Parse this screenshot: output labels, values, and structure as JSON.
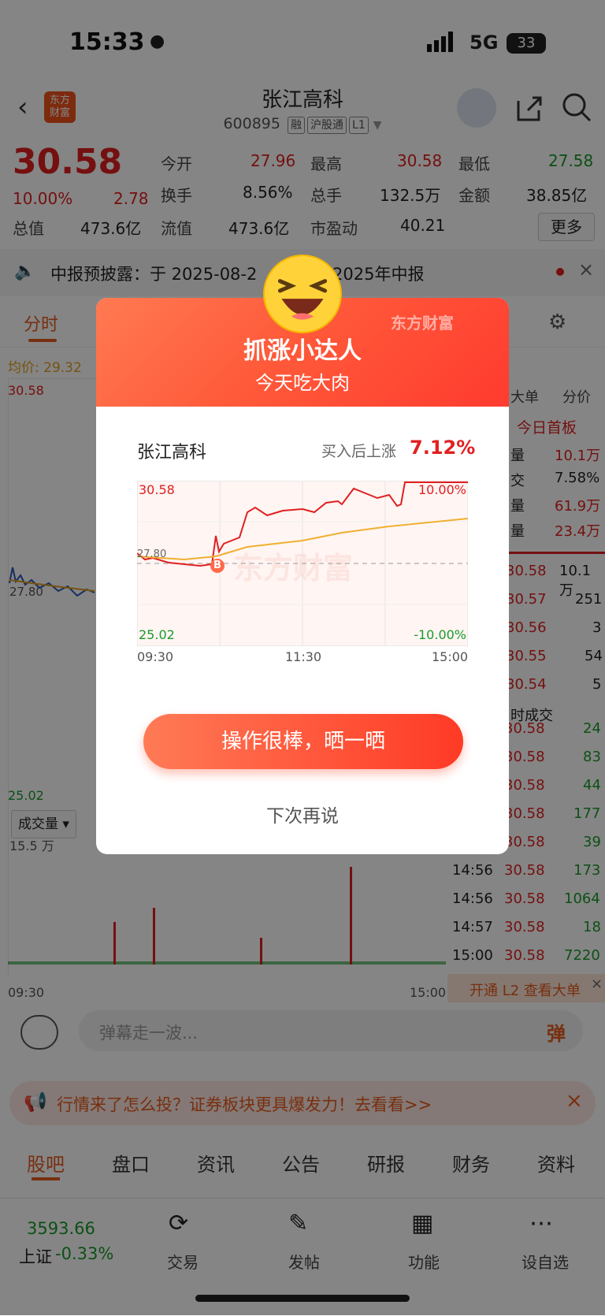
{
  "status_bar": {
    "time": "15:33",
    "network": "5G",
    "battery": "33"
  },
  "header": {
    "title": "张江高科",
    "code": "600895",
    "tags": [
      "融",
      "沪股通",
      "L1"
    ],
    "logo_text": "东方\n财富"
  },
  "quote": {
    "price": "30.58",
    "change_pct": "10.00%",
    "change": "2.78",
    "fields": [
      {
        "label": "今开",
        "value": "27.96",
        "color": "red"
      },
      {
        "label": "最高",
        "value": "30.58",
        "color": "red"
      },
      {
        "label": "最低",
        "value": "27.58",
        "color": "green"
      },
      {
        "label": "换手",
        "value": "8.56%",
        "color": "black"
      },
      {
        "label": "总手",
        "value": "132.5万",
        "color": "black"
      },
      {
        "label": "金额",
        "value": "38.85亿",
        "color": "black"
      },
      {
        "label": "总值",
        "value": "473.6亿",
        "color": "black"
      },
      {
        "label": "流值",
        "value": "473.6亿",
        "color": "black"
      },
      {
        "label": "市盈动",
        "value": "40.21",
        "color": "black"
      }
    ],
    "more_label": "更多"
  },
  "notice": {
    "text": "中报预披露：于 2025-08-2",
    "text_tail": "2025年中报"
  },
  "chart_tabs": {
    "active": "分时"
  },
  "main_chart": {
    "avg_label": "均价: 29.32",
    "high": "30.58",
    "low": "25.02",
    "base": "27.80",
    "vol_label": "成交量",
    "vol_max": "15.5 万",
    "x_start": "09:30",
    "x_end": "15:00"
  },
  "order_book": {
    "headers": [
      "大单",
      "分价"
    ],
    "first_board": "今日首板",
    "stats": [
      {
        "label": "量",
        "value": "10.1万",
        "color": "red"
      },
      {
        "label": "交",
        "value": "7.58%",
        "color": "black"
      },
      {
        "label": "量",
        "value": "61.9万",
        "color": "red"
      },
      {
        "label": "量",
        "value": "23.4万",
        "color": "red"
      }
    ],
    "levels": [
      {
        "price": "30.58",
        "vol": "10.1万"
      },
      {
        "price": "30.57",
        "vol": "251"
      },
      {
        "price": "30.56",
        "vol": "3"
      },
      {
        "price": "30.55",
        "vol": "54"
      },
      {
        "price": "30.54",
        "vol": "5"
      }
    ],
    "trades_title": "时成交",
    "trades": [
      {
        "time": "",
        "price": "30.58",
        "vol": "24"
      },
      {
        "time": "",
        "price": "30.58",
        "vol": "83"
      },
      {
        "time": "",
        "price": "30.58",
        "vol": "44"
      },
      {
        "time": "",
        "price": "30.58",
        "vol": "177"
      },
      {
        "time": "",
        "price": "30.58",
        "vol": "39"
      },
      {
        "time": "14:56",
        "price": "30.58",
        "vol": "173"
      },
      {
        "time": "14:56",
        "price": "30.58",
        "vol": "1064"
      },
      {
        "time": "14:57",
        "price": "30.58",
        "vol": "18"
      },
      {
        "time": "15:00",
        "price": "30.58",
        "vol": "7220"
      }
    ],
    "l2_banner": "开通 L2 查看大单"
  },
  "comment": {
    "placeholder": "弹幕走一波...",
    "danmu_label": "弹"
  },
  "promo": {
    "text": "行情来了怎么投？证券板块更具爆发力！去看看>>"
  },
  "bottom_tabs": [
    "股吧",
    "盘口",
    "资讯",
    "公告",
    "研报",
    "财务",
    "资料"
  ],
  "bottom_nav": {
    "index_value": "3593.66",
    "index_name": "上证",
    "index_change": "-0.33%",
    "items": [
      "交易",
      "发帖",
      "功能",
      "设自选"
    ]
  },
  "modal": {
    "brand": "东方财富",
    "title": "抓涨小达人",
    "subtitle": "今天吃大肉",
    "stock_name": "张江高科",
    "rise_label": "买入后上涨",
    "rise_value": "7.12%",
    "chart": {
      "high": "30.58",
      "low": "25.02",
      "base": "27.80",
      "high_pct": "10.00%",
      "low_pct": "-10.00%",
      "x_labels": [
        "09:30",
        "11:30",
        "15:00"
      ],
      "buy_marker": "B",
      "watermark": "东方财富"
    },
    "cta_label": "操作很棒，晒一晒",
    "later_label": "下次再说"
  },
  "colors": {
    "up": "#e02020",
    "down": "#1a9a2a",
    "accent": "#f0531e",
    "modal_gradient": "#ff4a30"
  }
}
